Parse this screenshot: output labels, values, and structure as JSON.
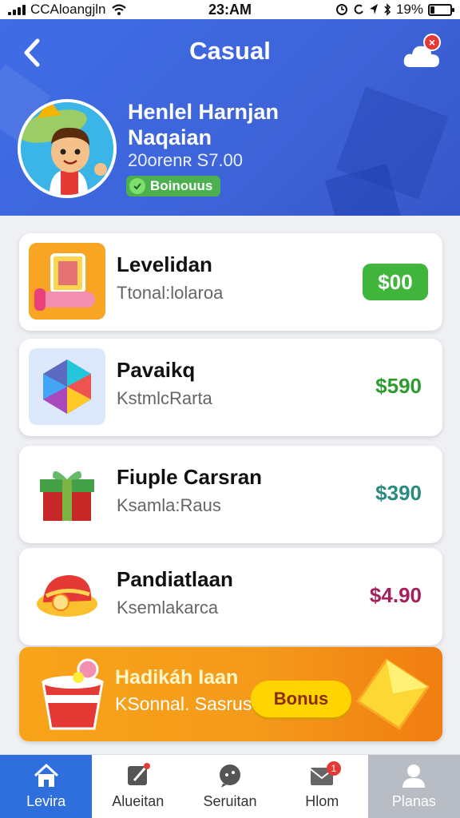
{
  "status_bar": {
    "carrier": "CCAloangjln",
    "time": "23:AM",
    "battery": "19%",
    "battery_level": 0.19
  },
  "header": {
    "title": "Casual",
    "notification_count": "×",
    "profile_name": "Henlel Harnjan Naqaian",
    "profile_sub": "20orenʀ S7.00",
    "bonus_tag": "Boinouus"
  },
  "items": [
    {
      "title": "Levelidan",
      "subtitle": "Ttonal:lolaroa",
      "price": "$00",
      "icon": "dumbbell-icon"
    },
    {
      "title": "Pavaikq",
      "subtitle": "KstmlcRarta",
      "price": "$590",
      "price_color": "#2e9b2e",
      "icon": "gem-icon"
    },
    {
      "title": "Fiuple Carsran",
      "subtitle": "Ksamla:Raus",
      "price": "$390",
      "price_color": "#2a8a7e",
      "icon": "gift-icon"
    },
    {
      "title": "Pandiatlaan",
      "subtitle": "Ksemlakarca",
      "price": "$4.90",
      "price_color": "#a3205a",
      "icon": "hat-icon"
    }
  ],
  "banner": {
    "title": "Hadikáh Iaan",
    "subtitle": "KSonnal. Sasrus",
    "button": "Bonus"
  },
  "nav": [
    {
      "label": "Levira",
      "icon": "home-icon"
    },
    {
      "label": "Alueitan",
      "icon": "edit-icon"
    },
    {
      "label": "Seruitan",
      "icon": "chat-icon"
    },
    {
      "label": "Hlom",
      "icon": "mail-icon",
      "badge": "1"
    },
    {
      "label": "Planas",
      "icon": "profile-icon"
    }
  ]
}
